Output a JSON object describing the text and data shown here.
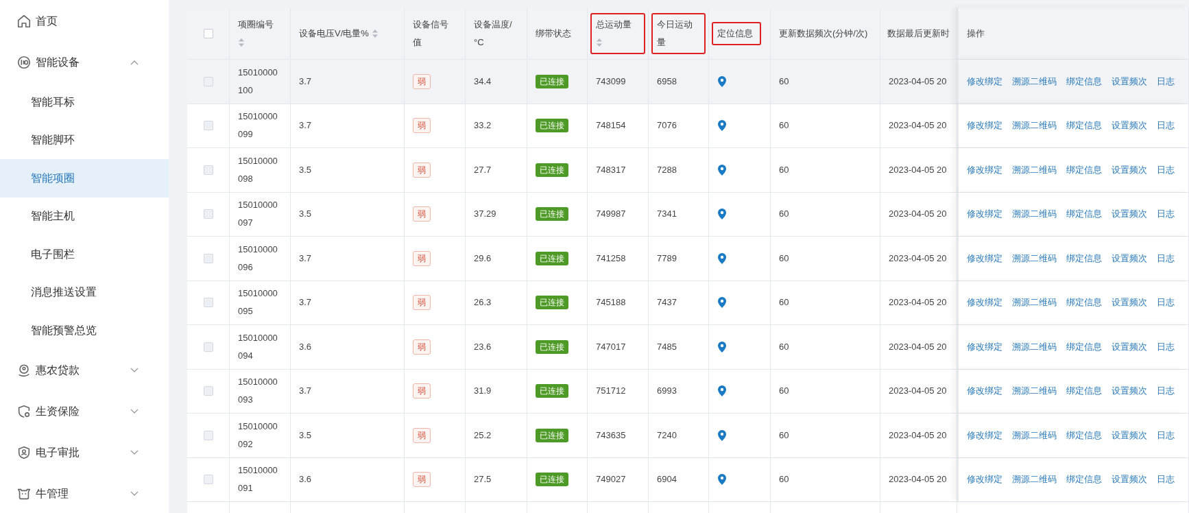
{
  "sidebar": {
    "items": [
      {
        "kind": "link",
        "label": "首页",
        "selected": false
      },
      {
        "kind": "group",
        "label": "智能设备",
        "expanded": true,
        "children": [
          {
            "label": "智能耳标",
            "selected": false
          },
          {
            "label": "智能脚环",
            "selected": false
          },
          {
            "label": "智能项圈",
            "selected": true
          },
          {
            "label": "智能主机",
            "selected": false
          },
          {
            "label": "电子围栏",
            "selected": false
          },
          {
            "label": "消息推送设置",
            "selected": false
          },
          {
            "label": "智能预警总览",
            "selected": false
          }
        ]
      },
      {
        "kind": "group",
        "label": "惠农贷款",
        "expanded": false
      },
      {
        "kind": "group",
        "label": "生资保险",
        "expanded": false
      },
      {
        "kind": "group",
        "label": "电子审批",
        "expanded": false
      },
      {
        "kind": "group",
        "label": "牛管理",
        "expanded": false
      }
    ]
  },
  "table": {
    "header_checkbox": {
      "checked": false
    },
    "columns": [
      {
        "label": "项圈编号",
        "sortable": true,
        "highlighted": false
      },
      {
        "label": "设备电压V/电量%",
        "sortable": true,
        "highlighted": false
      },
      {
        "label": "设备信号值",
        "sortable": false,
        "highlighted": false
      },
      {
        "label": "设备温度/°C",
        "sortable": false,
        "highlighted": false
      },
      {
        "label": "绑带状态",
        "sortable": false,
        "highlighted": false
      },
      {
        "label": "总运动量",
        "sortable": true,
        "highlighted": true
      },
      {
        "label": "今日运动量",
        "sortable": false,
        "highlighted": true
      },
      {
        "label": "定位信息",
        "sortable": false,
        "highlighted": true
      },
      {
        "label": "更新数据频次(分钟/次)",
        "sortable": false,
        "highlighted": false
      },
      {
        "label": "数据最后更新时",
        "sortable": false,
        "highlighted": false
      },
      {
        "label": "操作",
        "sortable": false,
        "highlighted": false
      }
    ],
    "rows": [
      {
        "hovered": true,
        "checked": false,
        "id": "15010000100",
        "voltage": "3.7",
        "signal": "弱",
        "temperature": "34.4",
        "status": "已连接",
        "total": "743099",
        "today": "6958",
        "frequency": "60",
        "updated": "2023-04-05 20",
        "actions": [
          "修改绑定",
          "溯源二维码",
          "绑定信息",
          "设置频次",
          "日志"
        ]
      },
      {
        "hovered": false,
        "checked": false,
        "id": "15010000099",
        "voltage": "3.7",
        "signal": "弱",
        "temperature": "33.2",
        "status": "已连接",
        "total": "748154",
        "today": "7076",
        "frequency": "60",
        "updated": "2023-04-05 20",
        "actions": [
          "修改绑定",
          "溯源二维码",
          "绑定信息",
          "设置频次",
          "日志"
        ]
      },
      {
        "hovered": false,
        "checked": false,
        "id": "15010000098",
        "voltage": "3.5",
        "signal": "弱",
        "temperature": "27.7",
        "status": "已连接",
        "total": "748317",
        "today": "7288",
        "frequency": "60",
        "updated": "2023-04-05 20",
        "actions": [
          "修改绑定",
          "溯源二维码",
          "绑定信息",
          "设置频次",
          "日志"
        ]
      },
      {
        "hovered": false,
        "checked": false,
        "id": "15010000097",
        "voltage": "3.5",
        "signal": "弱",
        "temperature": "37.29",
        "status": "已连接",
        "total": "749987",
        "today": "7341",
        "frequency": "60",
        "updated": "2023-04-05 20",
        "actions": [
          "修改绑定",
          "溯源二维码",
          "绑定信息",
          "设置频次",
          "日志"
        ]
      },
      {
        "hovered": false,
        "checked": false,
        "id": "15010000096",
        "voltage": "3.7",
        "signal": "弱",
        "temperature": "29.6",
        "status": "已连接",
        "total": "741258",
        "today": "7789",
        "frequency": "60",
        "updated": "2023-04-05 20",
        "actions": [
          "修改绑定",
          "溯源二维码",
          "绑定信息",
          "设置频次",
          "日志"
        ]
      },
      {
        "hovered": false,
        "checked": false,
        "id": "15010000095",
        "voltage": "3.7",
        "signal": "弱",
        "temperature": "26.3",
        "status": "已连接",
        "total": "745188",
        "today": "7437",
        "frequency": "60",
        "updated": "2023-04-05 20",
        "actions": [
          "修改绑定",
          "溯源二维码",
          "绑定信息",
          "设置频次",
          "日志"
        ]
      },
      {
        "hovered": false,
        "checked": false,
        "id": "15010000094",
        "voltage": "3.6",
        "signal": "弱",
        "temperature": "23.6",
        "status": "已连接",
        "total": "747017",
        "today": "7485",
        "frequency": "60",
        "updated": "2023-04-05 20",
        "actions": [
          "修改绑定",
          "溯源二维码",
          "绑定信息",
          "设置频次",
          "日志"
        ]
      },
      {
        "hovered": false,
        "checked": false,
        "id": "15010000093",
        "voltage": "3.7",
        "signal": "弱",
        "temperature": "31.9",
        "status": "已连接",
        "total": "751712",
        "today": "6993",
        "frequency": "60",
        "updated": "2023-04-05 20",
        "actions": [
          "修改绑定",
          "溯源二维码",
          "绑定信息",
          "设置频次",
          "日志"
        ]
      },
      {
        "hovered": false,
        "checked": false,
        "id": "15010000092",
        "voltage": "3.5",
        "signal": "弱",
        "temperature": "25.2",
        "status": "已连接",
        "total": "743635",
        "today": "7240",
        "frequency": "60",
        "updated": "2023-04-05 20",
        "actions": [
          "修改绑定",
          "溯源二维码",
          "绑定信息",
          "设置频次",
          "日志"
        ]
      },
      {
        "hovered": false,
        "checked": false,
        "id": "15010000091",
        "voltage": "3.6",
        "signal": "弱",
        "temperature": "27.5",
        "status": "已连接",
        "total": "749027",
        "today": "6904",
        "frequency": "60",
        "updated": "2023-04-05 20",
        "actions": [
          "修改绑定",
          "溯源二维码",
          "绑定信息",
          "设置频次",
          "日志"
        ]
      }
    ]
  }
}
